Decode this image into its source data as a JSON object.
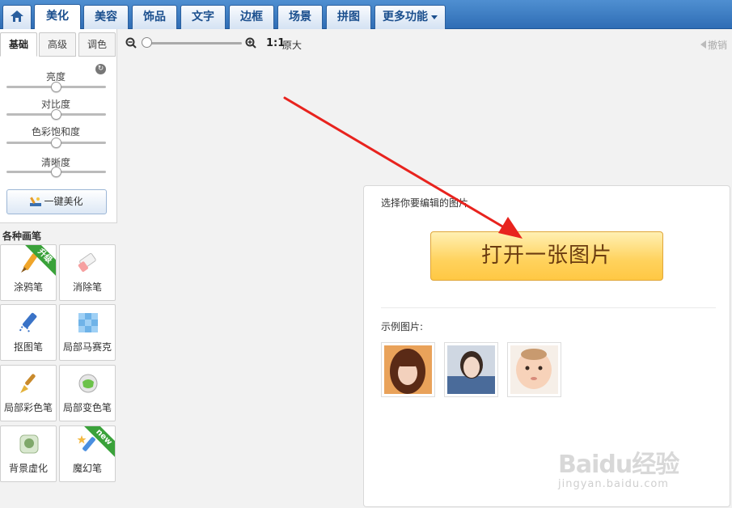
{
  "colors": {
    "topbar": "#3d7fc4",
    "open_button": "#ffd25c",
    "arrow": "#e8231e",
    "ribbon": "#3aa23a"
  },
  "tabs": [
    {
      "label": "",
      "icon": "home-icon"
    },
    {
      "label": "美化",
      "active": true
    },
    {
      "label": "美容"
    },
    {
      "label": "饰品"
    },
    {
      "label": "文字"
    },
    {
      "label": "边框"
    },
    {
      "label": "场景"
    },
    {
      "label": "拼图"
    },
    {
      "label": "更多功能",
      "icon": "caret-down-icon"
    }
  ],
  "adjust": {
    "subtabs": [
      "基础",
      "高级",
      "调色"
    ],
    "active_subtab": "基础",
    "sliders": [
      {
        "label": "亮度",
        "value": 0.5
      },
      {
        "label": "对比度",
        "value": 0.5
      },
      {
        "label": "色彩饱和度",
        "value": 0.5
      },
      {
        "label": "清晰度",
        "value": 0.5
      }
    ],
    "one_key_label": "一键美化"
  },
  "brushes": {
    "title": "各种画笔",
    "items": [
      {
        "label": "涂鸦笔",
        "badge": "升级",
        "icon": "crayon-icon"
      },
      {
        "label": "消除笔",
        "badge": "",
        "icon": "eraser-icon"
      },
      {
        "label": "抠图笔",
        "badge": "",
        "icon": "cutout-pen-icon"
      },
      {
        "label": "局部马赛克",
        "badge": "",
        "icon": "mosaic-icon"
      },
      {
        "label": "局部彩色笔",
        "badge": "",
        "icon": "color-brush-icon"
      },
      {
        "label": "局部变色笔",
        "badge": "",
        "icon": "color-change-icon"
      },
      {
        "label": "背景虚化",
        "badge": "",
        "icon": "blur-icon"
      },
      {
        "label": "魔幻笔",
        "badge": "new",
        "icon": "magic-pen-icon"
      }
    ]
  },
  "toolbar": {
    "zoom_value": 0,
    "ratio_label": "1:1",
    "original_label": "原大",
    "undo_label": "撤销"
  },
  "open": {
    "hint": "选择你要编辑的图片",
    "button_label": "打开一张图片",
    "samples_label": "示例图片:",
    "samples": [
      "sample-woman-bangs",
      "sample-woman-selfie",
      "sample-baby"
    ]
  },
  "watermark": {
    "main": "Baidu经验",
    "sub": "jingyan.baidu.com"
  }
}
